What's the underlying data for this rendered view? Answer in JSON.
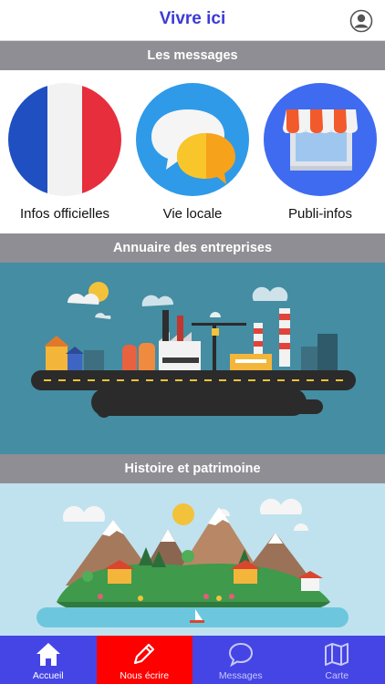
{
  "header": {
    "title": "Vivre ici",
    "profile_icon": "user-circle-icon"
  },
  "sections": {
    "messages": "Les messages",
    "directory": "Annuaire des entreprises",
    "heritage": "Histoire et patrimoine"
  },
  "messages": [
    {
      "label": "Infos officielles",
      "icon": "french-flag-icon"
    },
    {
      "label": "Vie locale",
      "icon": "chat-bubbles-icon"
    },
    {
      "label": "Publi-infos",
      "icon": "storefront-icon"
    }
  ],
  "tabs": [
    {
      "label": "Accueil",
      "icon": "home-icon"
    },
    {
      "label": "Nous écrire",
      "icon": "pencil-icon"
    },
    {
      "label": "Messages",
      "icon": "chat-icon"
    },
    {
      "label": "Carte",
      "icon": "map-icon"
    }
  ],
  "colors": {
    "accent": "#3b3bd6",
    "section_bar": "#8f8e94",
    "tabbar": "#4545e6",
    "tab_highlight": "#ff0000"
  }
}
